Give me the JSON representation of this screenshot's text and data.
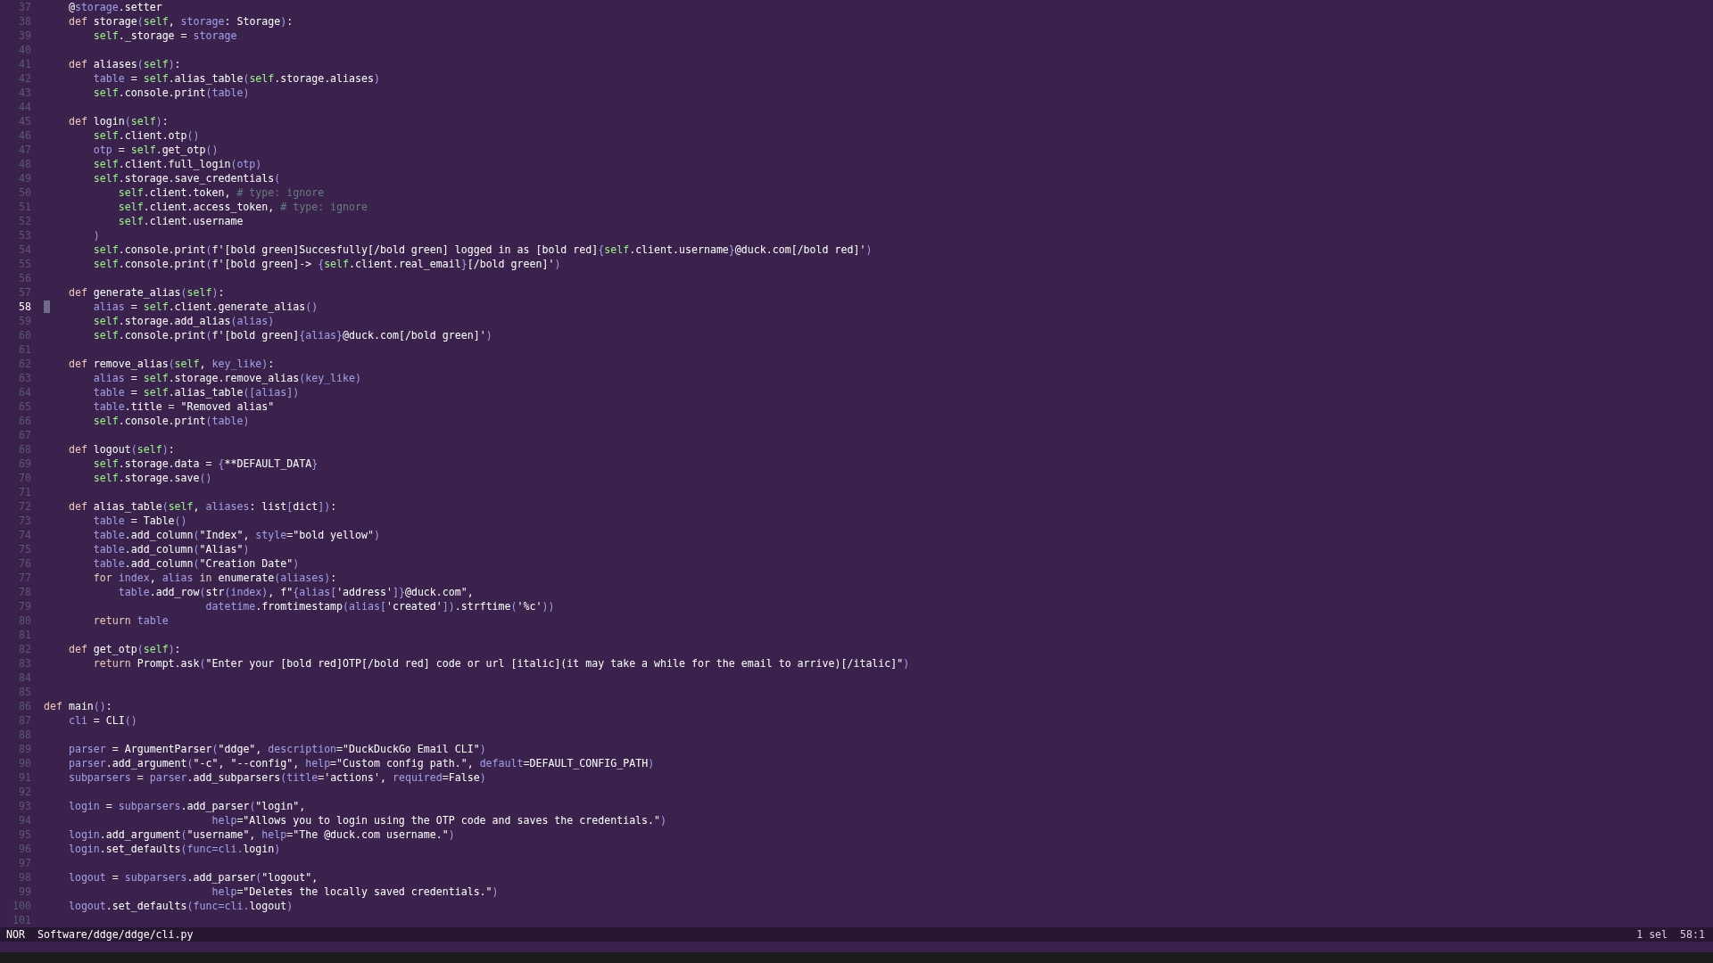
{
  "editor": {
    "lines": [
      {
        "number": "37",
        "current": false,
        "segments": [
          {
            "kind": "txt",
            "text": "    @"
          },
          {
            "kind": "var",
            "text": "storage"
          },
          {
            "kind": "txt",
            "text": ".setter"
          }
        ]
      },
      {
        "number": "38",
        "current": false,
        "segments": [
          {
            "kind": "kw",
            "text": "    def"
          },
          {
            "kind": "txt",
            "text": " storage"
          },
          {
            "kind": "var",
            "text": "("
          },
          {
            "kind": "self",
            "text": "self"
          },
          {
            "kind": "txt",
            "text": ", "
          },
          {
            "kind": "var",
            "text": "storage"
          },
          {
            "kind": "txt",
            "text": ": Storage"
          },
          {
            "kind": "var",
            "text": ")"
          },
          {
            "kind": "txt",
            "text": ":"
          }
        ]
      },
      {
        "number": "39",
        "current": false,
        "segments": [
          {
            "kind": "self",
            "text": "        self"
          },
          {
            "kind": "txt",
            "text": "._storage = "
          },
          {
            "kind": "var",
            "text": "storage"
          }
        ]
      },
      {
        "number": "40",
        "current": false
      },
      {
        "number": "41",
        "current": false,
        "segments": [
          {
            "kind": "kw",
            "text": "    def"
          },
          {
            "kind": "txt",
            "text": " aliases"
          },
          {
            "kind": "var",
            "text": "("
          },
          {
            "kind": "self",
            "text": "self"
          },
          {
            "kind": "var",
            "text": ")"
          },
          {
            "kind": "txt",
            "text": ":"
          }
        ]
      },
      {
        "number": "42",
        "current": false,
        "segments": [
          {
            "kind": "var",
            "text": "        table"
          },
          {
            "kind": "txt",
            "text": " = "
          },
          {
            "kind": "self",
            "text": "self"
          },
          {
            "kind": "txt",
            "text": ".alias_table"
          },
          {
            "kind": "var",
            "text": "("
          },
          {
            "kind": "self",
            "text": "self"
          },
          {
            "kind": "txt",
            "text": ".storage.aliases"
          },
          {
            "kind": "var",
            "text": ")"
          }
        ]
      },
      {
        "number": "43",
        "current": false,
        "segments": [
          {
            "kind": "self",
            "text": "        self"
          },
          {
            "kind": "txt",
            "text": ".console.print"
          },
          {
            "kind": "var",
            "text": "(table)"
          }
        ]
      },
      {
        "number": "44",
        "current": false
      },
      {
        "number": "45",
        "current": false,
        "segments": [
          {
            "kind": "kw",
            "text": "    def"
          },
          {
            "kind": "txt",
            "text": " login"
          },
          {
            "kind": "var",
            "text": "("
          },
          {
            "kind": "self",
            "text": "self"
          },
          {
            "kind": "var",
            "text": ")"
          },
          {
            "kind": "txt",
            "text": ":"
          }
        ]
      },
      {
        "number": "46",
        "current": false,
        "segments": [
          {
            "kind": "self",
            "text": "        self"
          },
          {
            "kind": "txt",
            "text": ".client.otp"
          },
          {
            "kind": "var",
            "text": "()"
          }
        ]
      },
      {
        "number": "47",
        "current": false,
        "segments": [
          {
            "kind": "var",
            "text": "        otp"
          },
          {
            "kind": "txt",
            "text": " = "
          },
          {
            "kind": "self",
            "text": "self"
          },
          {
            "kind": "txt",
            "text": ".get_otp"
          },
          {
            "kind": "var",
            "text": "()"
          }
        ]
      },
      {
        "number": "48",
        "current": false,
        "segments": [
          {
            "kind": "self",
            "text": "        self"
          },
          {
            "kind": "txt",
            "text": ".client.full_login"
          },
          {
            "kind": "var",
            "text": "(otp)"
          }
        ]
      },
      {
        "number": "49",
        "current": false,
        "segments": [
          {
            "kind": "self",
            "text": "        self"
          },
          {
            "kind": "txt",
            "text": ".storage.save_credentials"
          },
          {
            "kind": "var",
            "text": "("
          }
        ]
      },
      {
        "number": "50",
        "current": false,
        "segments": [
          {
            "kind": "self",
            "text": "            self"
          },
          {
            "kind": "txt",
            "text": ".client.token, "
          },
          {
            "kind": "cmt",
            "text": "# type: ignore"
          }
        ]
      },
      {
        "number": "51",
        "current": false,
        "segments": [
          {
            "kind": "self",
            "text": "            self"
          },
          {
            "kind": "txt",
            "text": ".client.access_token, "
          },
          {
            "kind": "cmt",
            "text": "# type: ignore"
          }
        ]
      },
      {
        "number": "52",
        "current": false,
        "segments": [
          {
            "kind": "self",
            "text": "            self"
          },
          {
            "kind": "txt",
            "text": ".client.username"
          }
        ]
      },
      {
        "number": "53",
        "current": false,
        "segments": [
          {
            "kind": "var",
            "text": "        )"
          }
        ]
      },
      {
        "number": "54",
        "current": false,
        "segments": [
          {
            "kind": "self",
            "text": "        self"
          },
          {
            "kind": "txt",
            "text": ".console.print"
          },
          {
            "kind": "var",
            "text": "("
          },
          {
            "kind": "txt",
            "text": "f'[bold green]Succesfully[/bold green] logged in as [bold red]"
          },
          {
            "kind": "var",
            "text": "{"
          },
          {
            "kind": "self",
            "text": "self"
          },
          {
            "kind": "txt",
            "text": ".client.username"
          },
          {
            "kind": "var",
            "text": "}"
          },
          {
            "kind": "txt",
            "text": "@duck.com[/bold red]'"
          },
          {
            "kind": "var",
            "text": ")"
          }
        ]
      },
      {
        "number": "55",
        "current": false,
        "segments": [
          {
            "kind": "self",
            "text": "        self"
          },
          {
            "kind": "txt",
            "text": ".console.print"
          },
          {
            "kind": "var",
            "text": "("
          },
          {
            "kind": "txt",
            "text": "f'[bold green]-> "
          },
          {
            "kind": "var",
            "text": "{"
          },
          {
            "kind": "self",
            "text": "self"
          },
          {
            "kind": "txt",
            "text": ".client.real_email"
          },
          {
            "kind": "var",
            "text": "}"
          },
          {
            "kind": "txt",
            "text": "[/bold green]'"
          },
          {
            "kind": "var",
            "text": ")"
          }
        ]
      },
      {
        "number": "56",
        "current": false
      },
      {
        "number": "57",
        "current": false,
        "segments": [
          {
            "kind": "kw",
            "text": "    def"
          },
          {
            "kind": "txt",
            "text": " generate_alias"
          },
          {
            "kind": "var",
            "text": "("
          },
          {
            "kind": "self",
            "text": "self"
          },
          {
            "kind": "var",
            "text": ")"
          },
          {
            "kind": "txt",
            "text": ":"
          }
        ]
      },
      {
        "number": "58",
        "current": true,
        "segments": [
          {
            "kind": "var",
            "text": "        alias"
          },
          {
            "kind": "txt",
            "text": " = "
          },
          {
            "kind": "self",
            "text": "self"
          },
          {
            "kind": "txt",
            "text": ".client.generate_alias"
          },
          {
            "kind": "var",
            "text": "()"
          }
        ]
      },
      {
        "number": "59",
        "current": false,
        "segments": [
          {
            "kind": "self",
            "text": "        self"
          },
          {
            "kind": "txt",
            "text": ".storage.add_alias"
          },
          {
            "kind": "var",
            "text": "(alias)"
          }
        ]
      },
      {
        "number": "60",
        "current": false,
        "segments": [
          {
            "kind": "self",
            "text": "        self"
          },
          {
            "kind": "txt",
            "text": ".console.print"
          },
          {
            "kind": "var",
            "text": "("
          },
          {
            "kind": "txt",
            "text": "f'[bold green]"
          },
          {
            "kind": "var",
            "text": "{alias}"
          },
          {
            "kind": "txt",
            "text": "@duck.com[/bold green]'"
          },
          {
            "kind": "var",
            "text": ")"
          }
        ]
      },
      {
        "number": "61",
        "current": false
      },
      {
        "number": "62",
        "current": false,
        "segments": [
          {
            "kind": "kw",
            "text": "    def"
          },
          {
            "kind": "txt",
            "text": " remove_alias"
          },
          {
            "kind": "var",
            "text": "("
          },
          {
            "kind": "self",
            "text": "self"
          },
          {
            "kind": "txt",
            "text": ", "
          },
          {
            "kind": "var",
            "text": "key_like)"
          },
          {
            "kind": "txt",
            "text": ":"
          }
        ]
      },
      {
        "number": "63",
        "current": false,
        "segments": [
          {
            "kind": "var",
            "text": "        alias"
          },
          {
            "kind": "txt",
            "text": " = "
          },
          {
            "kind": "self",
            "text": "self"
          },
          {
            "kind": "txt",
            "text": ".storage.remove_alias"
          },
          {
            "kind": "var",
            "text": "(key_like)"
          }
        ]
      },
      {
        "number": "64",
        "current": false,
        "segments": [
          {
            "kind": "var",
            "text": "        table"
          },
          {
            "kind": "txt",
            "text": " = "
          },
          {
            "kind": "self",
            "text": "self"
          },
          {
            "kind": "txt",
            "text": ".alias_table"
          },
          {
            "kind": "var",
            "text": "([alias])"
          }
        ]
      },
      {
        "number": "65",
        "current": false,
        "segments": [
          {
            "kind": "var",
            "text": "        table"
          },
          {
            "kind": "txt",
            "text": ".title = \"Removed alias\""
          }
        ]
      },
      {
        "number": "66",
        "current": false,
        "segments": [
          {
            "kind": "self",
            "text": "        self"
          },
          {
            "kind": "txt",
            "text": ".console.print"
          },
          {
            "kind": "var",
            "text": "(table)"
          }
        ]
      },
      {
        "number": "67",
        "current": false
      },
      {
        "number": "68",
        "current": false,
        "segments": [
          {
            "kind": "kw",
            "text": "    def"
          },
          {
            "kind": "txt",
            "text": " logout"
          },
          {
            "kind": "var",
            "text": "("
          },
          {
            "kind": "self",
            "text": "self"
          },
          {
            "kind": "var",
            "text": ")"
          },
          {
            "kind": "txt",
            "text": ":"
          }
        ]
      },
      {
        "number": "69",
        "current": false,
        "segments": [
          {
            "kind": "self",
            "text": "        self"
          },
          {
            "kind": "txt",
            "text": ".storage.data = "
          },
          {
            "kind": "var",
            "text": "{"
          },
          {
            "kind": "txt",
            "text": "**DEFAULT_DATA"
          },
          {
            "kind": "var",
            "text": "}"
          }
        ]
      },
      {
        "number": "70",
        "current": false,
        "segments": [
          {
            "kind": "self",
            "text": "        self"
          },
          {
            "kind": "txt",
            "text": ".storage.save"
          },
          {
            "kind": "var",
            "text": "()"
          }
        ]
      },
      {
        "number": "71",
        "current": false
      },
      {
        "number": "72",
        "current": false,
        "segments": [
          {
            "kind": "kw",
            "text": "    def"
          },
          {
            "kind": "txt",
            "text": " alias_table"
          },
          {
            "kind": "var",
            "text": "("
          },
          {
            "kind": "self",
            "text": "self"
          },
          {
            "kind": "txt",
            "text": ", "
          },
          {
            "kind": "var",
            "text": "aliases"
          },
          {
            "kind": "txt",
            "text": ": list"
          },
          {
            "kind": "var",
            "text": "["
          },
          {
            "kind": "txt",
            "text": "dict"
          },
          {
            "kind": "var",
            "text": "])"
          },
          {
            "kind": "txt",
            "text": ":"
          }
        ]
      },
      {
        "number": "73",
        "current": false,
        "segments": [
          {
            "kind": "var",
            "text": "        table"
          },
          {
            "kind": "txt",
            "text": " = Table"
          },
          {
            "kind": "var",
            "text": "()"
          }
        ]
      },
      {
        "number": "74",
        "current": false,
        "segments": [
          {
            "kind": "var",
            "text": "        table"
          },
          {
            "kind": "txt",
            "text": ".add_column"
          },
          {
            "kind": "var",
            "text": "("
          },
          {
            "kind": "txt",
            "text": "\"Index\", "
          },
          {
            "kind": "var",
            "text": "style"
          },
          {
            "kind": "txt",
            "text": "=\"bold yellow\""
          },
          {
            "kind": "var",
            "text": ")"
          }
        ]
      },
      {
        "number": "75",
        "current": false,
        "segments": [
          {
            "kind": "var",
            "text": "        table"
          },
          {
            "kind": "txt",
            "text": ".add_column"
          },
          {
            "kind": "var",
            "text": "("
          },
          {
            "kind": "txt",
            "text": "\"Alias\""
          },
          {
            "kind": "var",
            "text": ")"
          }
        ]
      },
      {
        "number": "76",
        "current": false,
        "segments": [
          {
            "kind": "var",
            "text": "        table"
          },
          {
            "kind": "txt",
            "text": ".add_column"
          },
          {
            "kind": "var",
            "text": "("
          },
          {
            "kind": "txt",
            "text": "\"Creation Date\""
          },
          {
            "kind": "var",
            "text": ")"
          }
        ]
      },
      {
        "number": "77",
        "current": false,
        "segments": [
          {
            "kind": "kw",
            "text": "        for"
          },
          {
            "kind": "var",
            "text": " index"
          },
          {
            "kind": "txt",
            "text": ", "
          },
          {
            "kind": "var",
            "text": "alias"
          },
          {
            "kind": "kw",
            "text": " in"
          },
          {
            "kind": "txt",
            "text": " enumerate"
          },
          {
            "kind": "var",
            "text": "(aliases)"
          },
          {
            "kind": "txt",
            "text": ":"
          }
        ]
      },
      {
        "number": "78",
        "current": false,
        "segments": [
          {
            "kind": "var",
            "text": "            table"
          },
          {
            "kind": "txt",
            "text": ".add_row"
          },
          {
            "kind": "var",
            "text": "("
          },
          {
            "kind": "txt",
            "text": "str"
          },
          {
            "kind": "var",
            "text": "(index)"
          },
          {
            "kind": "txt",
            "text": ", f\""
          },
          {
            "kind": "var",
            "text": "{alias["
          },
          {
            "kind": "txt",
            "text": "'address'"
          },
          {
            "kind": "var",
            "text": "]}"
          },
          {
            "kind": "txt",
            "text": "@duck.com\","
          }
        ]
      },
      {
        "number": "79",
        "current": false,
        "segments": [
          {
            "kind": "var",
            "text": "                          datetime"
          },
          {
            "kind": "txt",
            "text": ".fromtimestamp"
          },
          {
            "kind": "var",
            "text": "(alias["
          },
          {
            "kind": "txt",
            "text": "'created'"
          },
          {
            "kind": "var",
            "text": "])"
          },
          {
            "kind": "txt",
            "text": ".strftime"
          },
          {
            "kind": "var",
            "text": "("
          },
          {
            "kind": "txt",
            "text": "'%c'"
          },
          {
            "kind": "var",
            "text": "))"
          }
        ]
      },
      {
        "number": "80",
        "current": false,
        "segments": [
          {
            "kind": "kw",
            "text": "        return"
          },
          {
            "kind": "var",
            "text": " table"
          }
        ]
      },
      {
        "number": "81",
        "current": false
      },
      {
        "number": "82",
        "current": false,
        "segments": [
          {
            "kind": "kw",
            "text": "    def"
          },
          {
            "kind": "txt",
            "text": " get_otp"
          },
          {
            "kind": "var",
            "text": "("
          },
          {
            "kind": "self",
            "text": "self"
          },
          {
            "kind": "var",
            "text": ")"
          },
          {
            "kind": "txt",
            "text": ":"
          }
        ]
      },
      {
        "number": "83",
        "current": false,
        "segments": [
          {
            "kind": "kw",
            "text": "        return"
          },
          {
            "kind": "txt",
            "text": " Prompt.ask"
          },
          {
            "kind": "var",
            "text": "("
          },
          {
            "kind": "txt",
            "text": "\"Enter your [bold red]OTP[/bold red] code or url [italic](it may take a while for the email to arrive)[/italic]\""
          },
          {
            "kind": "var",
            "text": ")"
          }
        ]
      },
      {
        "number": "84",
        "current": false
      },
      {
        "number": "85",
        "current": false
      },
      {
        "number": "86",
        "current": false,
        "segments": [
          {
            "kind": "kw",
            "text": "def"
          },
          {
            "kind": "txt",
            "text": " main"
          },
          {
            "kind": "var",
            "text": "()"
          },
          {
            "kind": "txt",
            "text": ":"
          }
        ]
      },
      {
        "number": "87",
        "current": false,
        "segments": [
          {
            "kind": "var",
            "text": "    cli"
          },
          {
            "kind": "txt",
            "text": " = CLI"
          },
          {
            "kind": "var",
            "text": "()"
          }
        ]
      },
      {
        "number": "88",
        "current": false
      },
      {
        "number": "89",
        "current": false,
        "segments": [
          {
            "kind": "var",
            "text": "    parser"
          },
          {
            "kind": "txt",
            "text": " = ArgumentParser"
          },
          {
            "kind": "var",
            "text": "("
          },
          {
            "kind": "txt",
            "text": "\"ddge\", "
          },
          {
            "kind": "var",
            "text": "description"
          },
          {
            "kind": "txt",
            "text": "=\"DuckDuckGo Email CLI\""
          },
          {
            "kind": "var",
            "text": ")"
          }
        ]
      },
      {
        "number": "90",
        "current": false,
        "segments": [
          {
            "kind": "var",
            "text": "    parser"
          },
          {
            "kind": "txt",
            "text": ".add_argument"
          },
          {
            "kind": "var",
            "text": "("
          },
          {
            "kind": "txt",
            "text": "\"-c\", \"--config\", "
          },
          {
            "kind": "var",
            "text": "help"
          },
          {
            "kind": "txt",
            "text": "=\"Custom config path.\", "
          },
          {
            "kind": "var",
            "text": "default"
          },
          {
            "kind": "txt",
            "text": "=DEFAULT_CONFIG_PATH"
          },
          {
            "kind": "var",
            "text": ")"
          }
        ]
      },
      {
        "number": "91",
        "current": false,
        "segments": [
          {
            "kind": "var",
            "text": "    subparsers"
          },
          {
            "kind": "txt",
            "text": " = "
          },
          {
            "kind": "var",
            "text": "parser"
          },
          {
            "kind": "txt",
            "text": ".add_subparsers"
          },
          {
            "kind": "var",
            "text": "(title"
          },
          {
            "kind": "txt",
            "text": "='actions', "
          },
          {
            "kind": "var",
            "text": "required"
          },
          {
            "kind": "txt",
            "text": "=False"
          },
          {
            "kind": "var",
            "text": ")"
          }
        ]
      },
      {
        "number": "92",
        "current": false
      },
      {
        "number": "93",
        "current": false,
        "segments": [
          {
            "kind": "var",
            "text": "    login"
          },
          {
            "kind": "txt",
            "text": " = "
          },
          {
            "kind": "var",
            "text": "subparsers"
          },
          {
            "kind": "txt",
            "text": ".add_parser"
          },
          {
            "kind": "var",
            "text": "("
          },
          {
            "kind": "txt",
            "text": "\"login\","
          }
        ]
      },
      {
        "number": "94",
        "current": false,
        "segments": [
          {
            "kind": "var",
            "text": "                           help"
          },
          {
            "kind": "txt",
            "text": "=\"Allows you to login using the OTP code and saves the credentials.\""
          },
          {
            "kind": "var",
            "text": ")"
          }
        ]
      },
      {
        "number": "95",
        "current": false,
        "segments": [
          {
            "kind": "var",
            "text": "    login"
          },
          {
            "kind": "txt",
            "text": ".add_argument"
          },
          {
            "kind": "var",
            "text": "("
          },
          {
            "kind": "txt",
            "text": "\"username\", "
          },
          {
            "kind": "var",
            "text": "help"
          },
          {
            "kind": "txt",
            "text": "=\"The @duck.com username.\""
          },
          {
            "kind": "var",
            "text": ")"
          }
        ]
      },
      {
        "number": "96",
        "current": false,
        "segments": [
          {
            "kind": "var",
            "text": "    login"
          },
          {
            "kind": "txt",
            "text": ".set_defaults"
          },
          {
            "kind": "var",
            "text": "(func=cli."
          },
          {
            "kind": "txt",
            "text": "login"
          },
          {
            "kind": "var",
            "text": ")"
          }
        ]
      },
      {
        "number": "97",
        "current": false
      },
      {
        "number": "98",
        "current": false,
        "segments": [
          {
            "kind": "var",
            "text": "    logout"
          },
          {
            "kind": "txt",
            "text": " = "
          },
          {
            "kind": "var",
            "text": "subparsers"
          },
          {
            "kind": "txt",
            "text": ".add_parser"
          },
          {
            "kind": "var",
            "text": "("
          },
          {
            "kind": "txt",
            "text": "\"logout\","
          }
        ]
      },
      {
        "number": "99",
        "current": false,
        "segments": [
          {
            "kind": "var",
            "text": "                           help"
          },
          {
            "kind": "txt",
            "text": "=\"Deletes the locally saved credentials.\""
          },
          {
            "kind": "var",
            "text": ")"
          }
        ]
      },
      {
        "number": "100",
        "current": false,
        "segments": [
          {
            "kind": "var",
            "text": "    logout"
          },
          {
            "kind": "txt",
            "text": ".set_defaults"
          },
          {
            "kind": "var",
            "text": "(func=cli."
          },
          {
            "kind": "txt",
            "text": "logout"
          },
          {
            "kind": "var",
            "text": ")"
          }
        ]
      },
      {
        "number": "101",
        "current": false
      }
    ]
  },
  "status_bar": {
    "mode": "NOR",
    "file_path": "Software/ddge/ddge/cli.py",
    "selections": "1 sel",
    "position": "58:1"
  }
}
